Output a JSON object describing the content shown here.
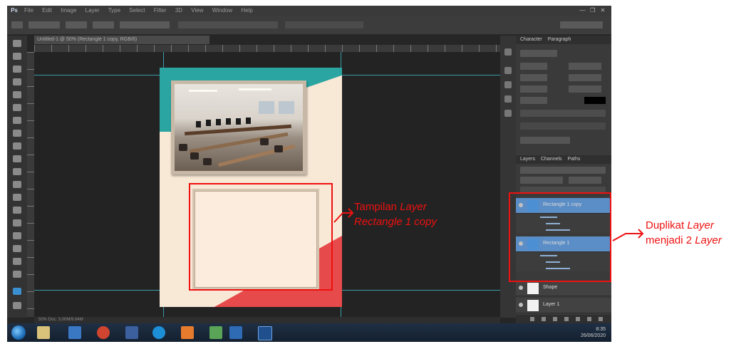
{
  "photoshop": {
    "app_logo": "Ps",
    "menus": [
      "File",
      "Edit",
      "Image",
      "Layer",
      "Type",
      "Select",
      "Filter",
      "3D",
      "View",
      "Window",
      "Help"
    ],
    "window_controls": [
      "—",
      "❐",
      "✕"
    ],
    "document_tab": "Untitled-1 @ 50% (Rectangle 1 copy, RGB/8)",
    "status_bar": "50%     Doc: 3.00M/9.84M",
    "panels": {
      "character_tabs": [
        "Character",
        "Paragraph"
      ],
      "layers_tabs": [
        "Layers",
        "Channels",
        "Paths"
      ],
      "layers": [
        {
          "name": "Rectangle 1 copy",
          "selected": true,
          "thumb": "blue"
        },
        {
          "name": "Rectangle 1",
          "selected": false,
          "thumb": "blue"
        },
        {
          "name": "Shape",
          "selected": false,
          "thumb": "white"
        },
        {
          "name": "Layer 1",
          "selected": false,
          "thumb": "white"
        }
      ]
    },
    "taskbar": {
      "time": "8:35",
      "date": "26/06/2020"
    }
  },
  "annotations": {
    "canvas_callout": {
      "line1_plain": "Tampilan ",
      "line1_italic": "Layer",
      "line2_italic": "Rectangle 1 copy"
    },
    "layers_callout": {
      "line1_plain": "Duplikat ",
      "line1_italic": "Layer",
      "line2_plain": "menjadi 2 ",
      "line2_italic": "Layer"
    },
    "highlight_color": "#ee1111"
  },
  "colors": {
    "doc_background": "#f8e8d6",
    "teal_accent": "#2aa5a2",
    "coral_accent": "#e74a4a",
    "workspace": "#262626",
    "guide": "#3a9aa8",
    "selected_layer": "#5b8dc6"
  }
}
